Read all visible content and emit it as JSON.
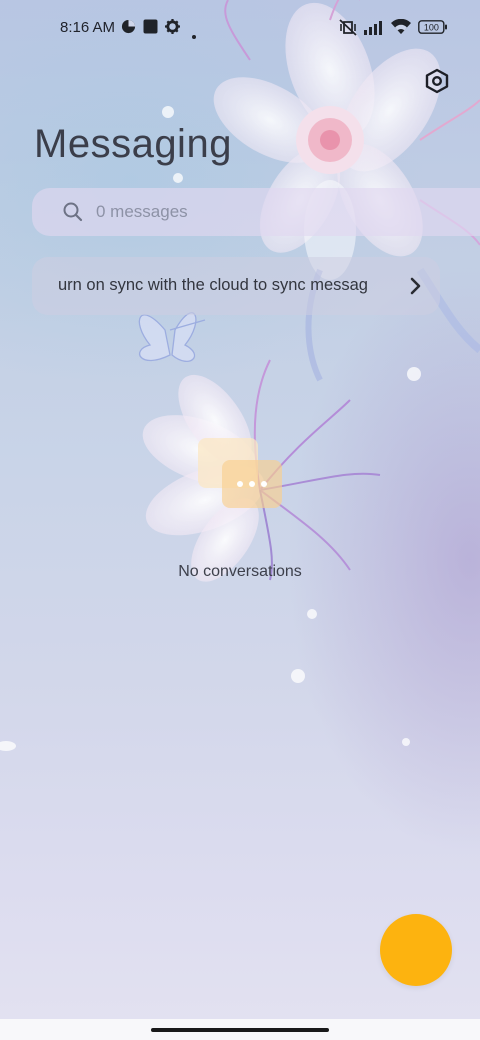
{
  "status_bar": {
    "time": "8:16 AM",
    "battery": "100",
    "icons": [
      "data-saver-icon",
      "square-notification-icon",
      "gear-icon",
      "dot-icon",
      "vibrate-off-icon",
      "signal-icon",
      "wifi-icon",
      "battery-icon"
    ]
  },
  "header": {
    "title": "Messaging",
    "settings_icon": "hexagon-settings-icon"
  },
  "search": {
    "placeholder": "0 messages"
  },
  "sync_banner": {
    "text": "urn on sync with the cloud to sync messag"
  },
  "empty_state": {
    "text": "No conversations"
  },
  "fab": {
    "color": "#fdb30f"
  },
  "colors": {
    "accent": "#fdb30f",
    "background_top": "#b9c6e3",
    "background_bottom": "#e3e2f1"
  }
}
